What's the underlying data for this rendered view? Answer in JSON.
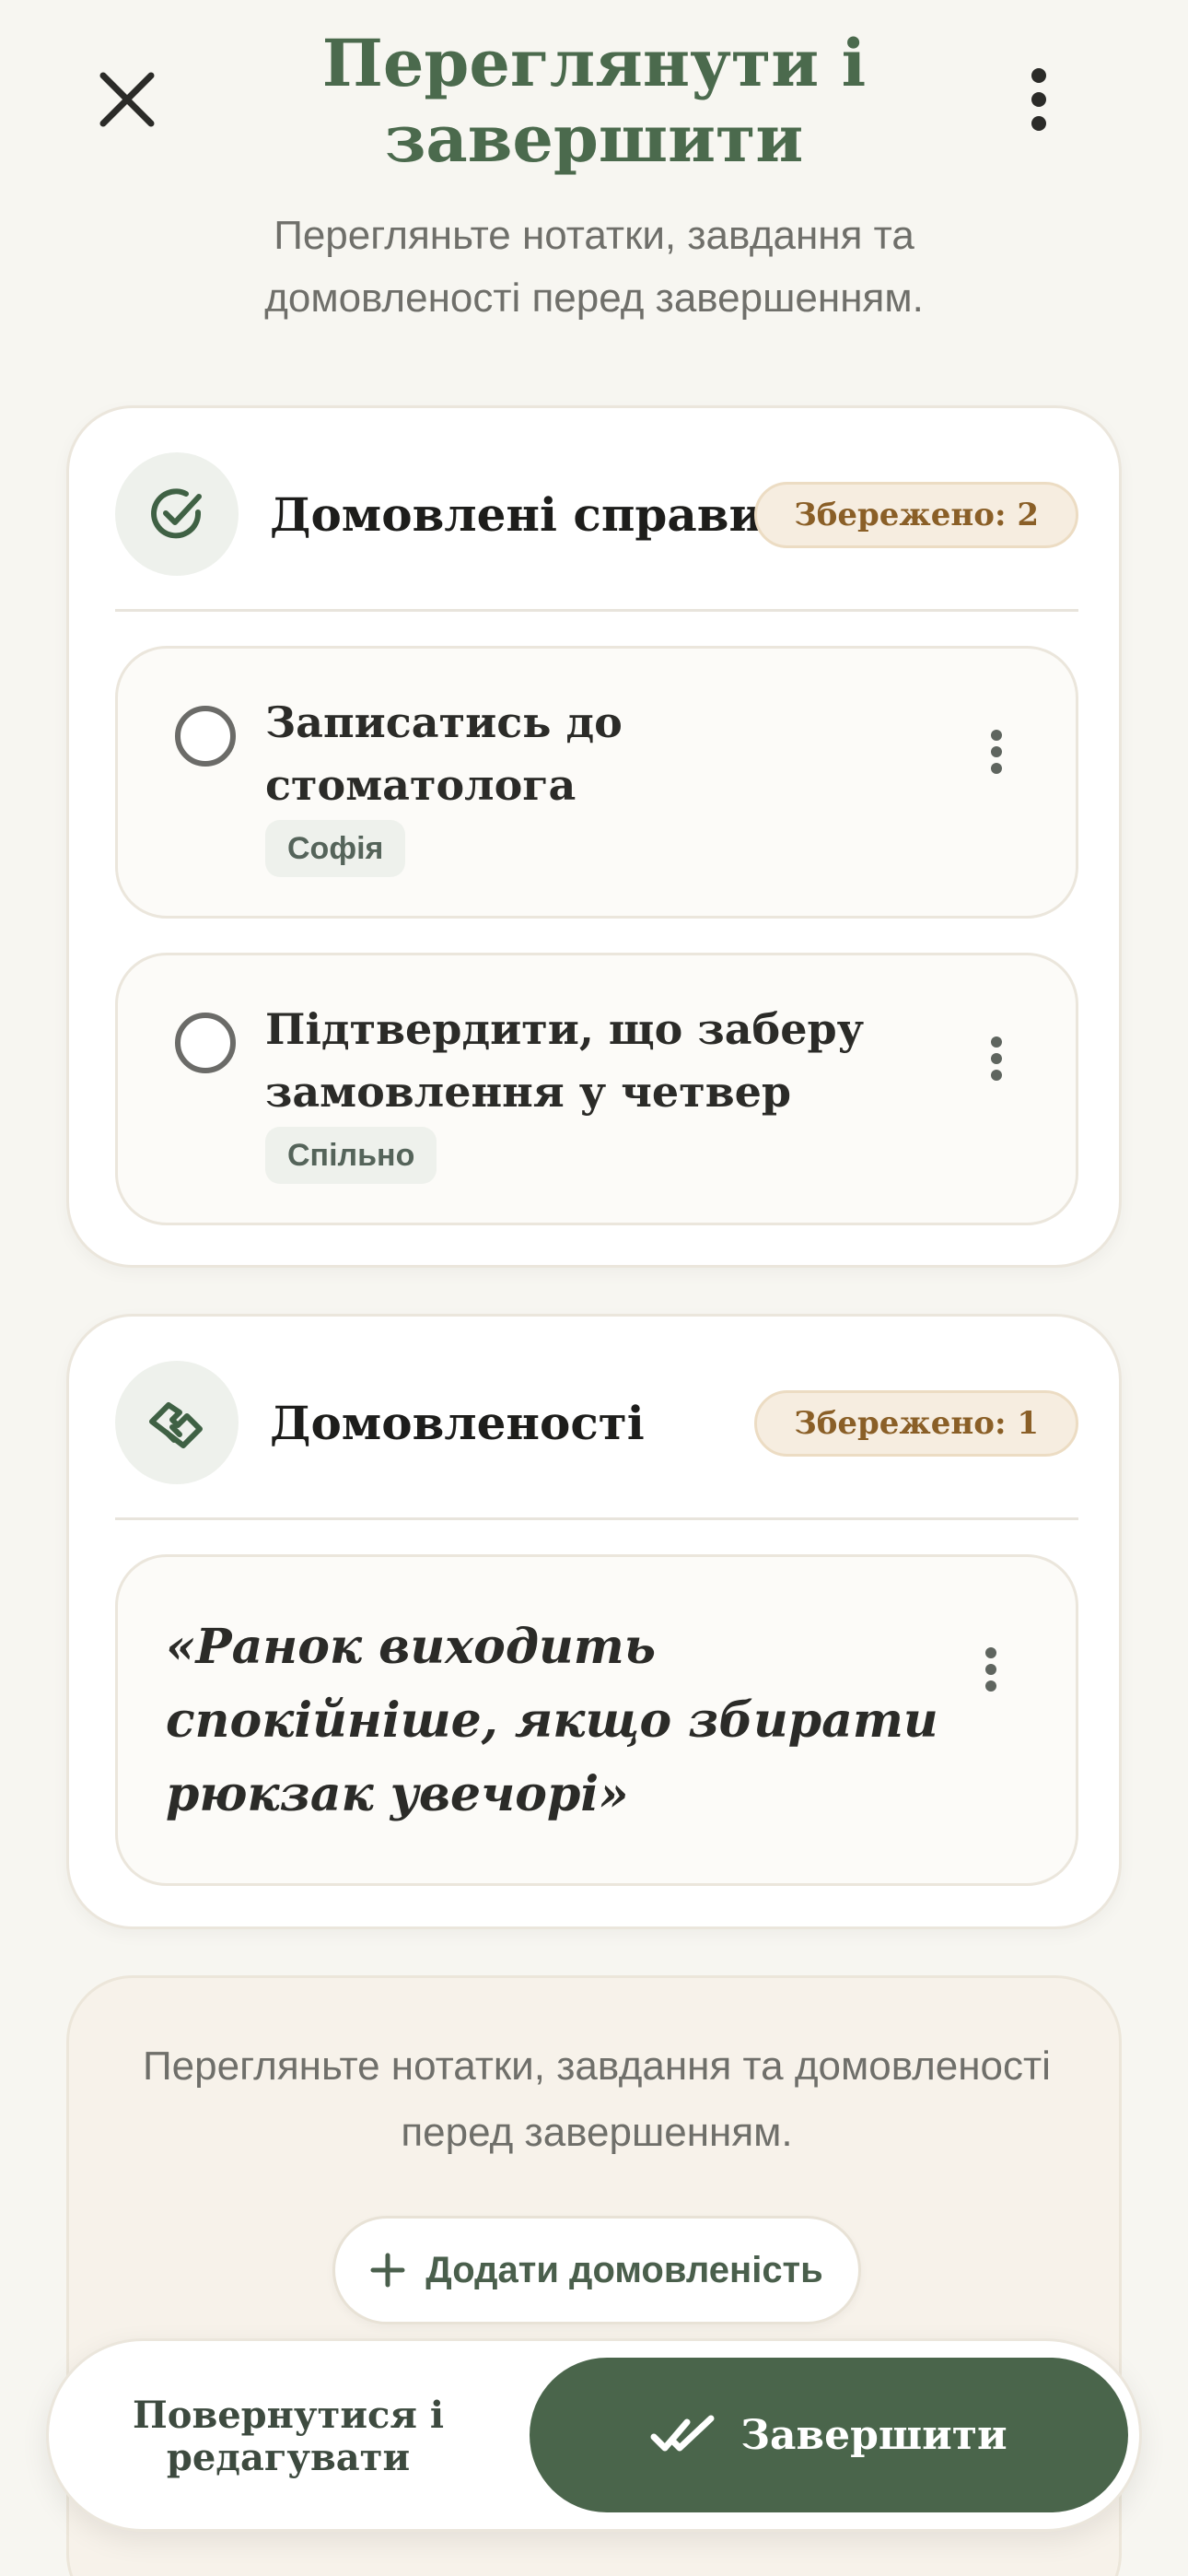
{
  "header": {
    "title": "Переглянути і завершити",
    "subtitle": "Перегляньте нотатки, завдання та домовленості перед завершенням."
  },
  "todos": {
    "title": "Домовлені справи",
    "badge": "Збережено: 2",
    "items": [
      {
        "title": "Записатись до стоматолога",
        "assignee": "Софія"
      },
      {
        "title": "Підтвердити, що заберу замовлення у четвер",
        "assignee": "Спільно"
      }
    ]
  },
  "agreements": {
    "title": "Домовленості",
    "badge": "Збережено: 1",
    "items": [
      {
        "text": "«Ранок виходить спокійніше, якщо збирати рюкзак увечорі»"
      }
    ]
  },
  "info": {
    "text": "Перегляньте нотатки, завдання та домовленості перед завершенням.",
    "add_button": "Додати домовленість"
  },
  "footer": {
    "back_button": "Повернутися і редагувати",
    "finish_button": "Завершити"
  },
  "colors": {
    "accent": "#4a654b",
    "background": "#f7f6f1",
    "badge_bg": "#f6ede0",
    "badge_text": "#8a5f27"
  }
}
